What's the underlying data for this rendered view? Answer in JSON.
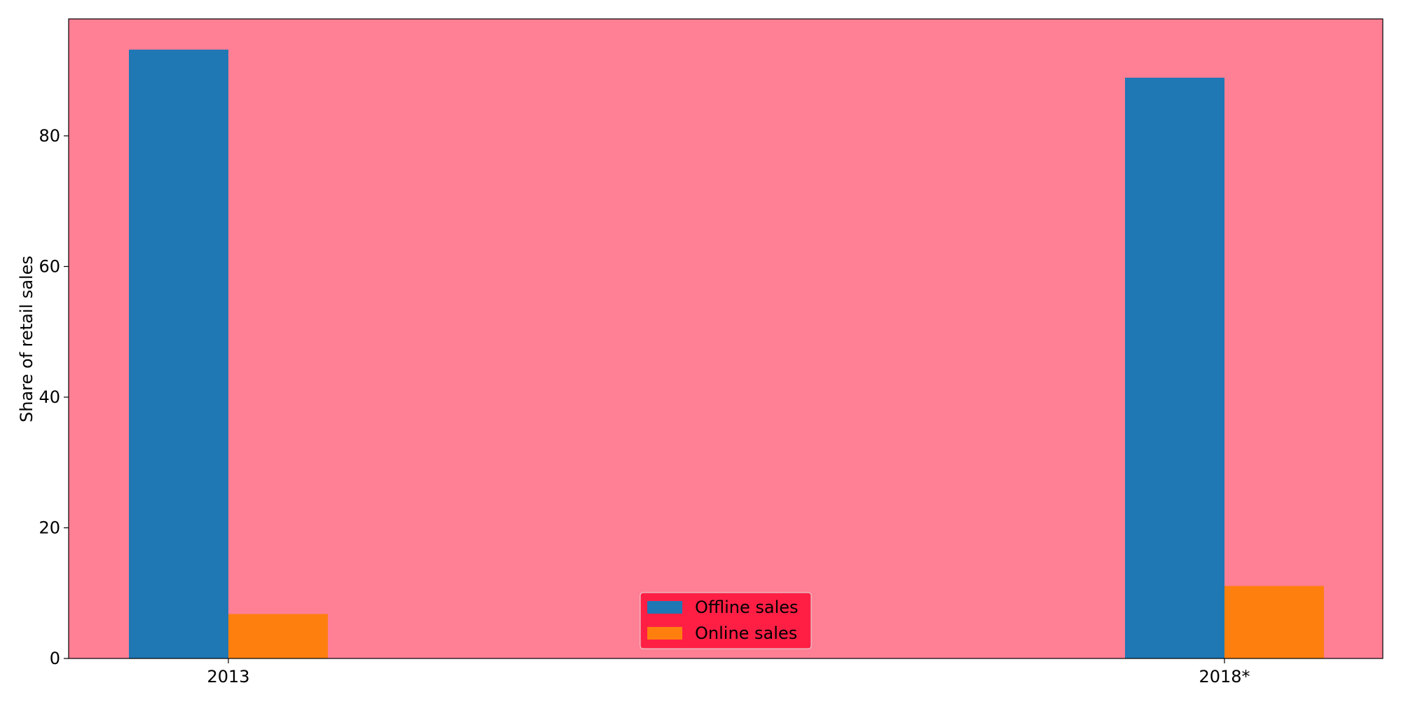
{
  "chart_data": {
    "type": "bar",
    "categories": [
      "2013",
      "2018*"
    ],
    "series": [
      {
        "name": "Offline sales",
        "color": "#1f77b4",
        "values": [
          93.2,
          88.9
        ]
      },
      {
        "name": "Online sales",
        "color": "#ff7f0e",
        "values": [
          6.8,
          11.1
        ]
      }
    ],
    "xlabel": "",
    "ylabel": "Share of retail sales",
    "ylim": [
      0,
      97.9
    ],
    "yticks": [
      0,
      20,
      40,
      60,
      80
    ],
    "grid": false,
    "legend_position": "bottom-center",
    "colors": {
      "plot_background": "#ff7f95",
      "legend_background": "#ff1f45"
    }
  }
}
